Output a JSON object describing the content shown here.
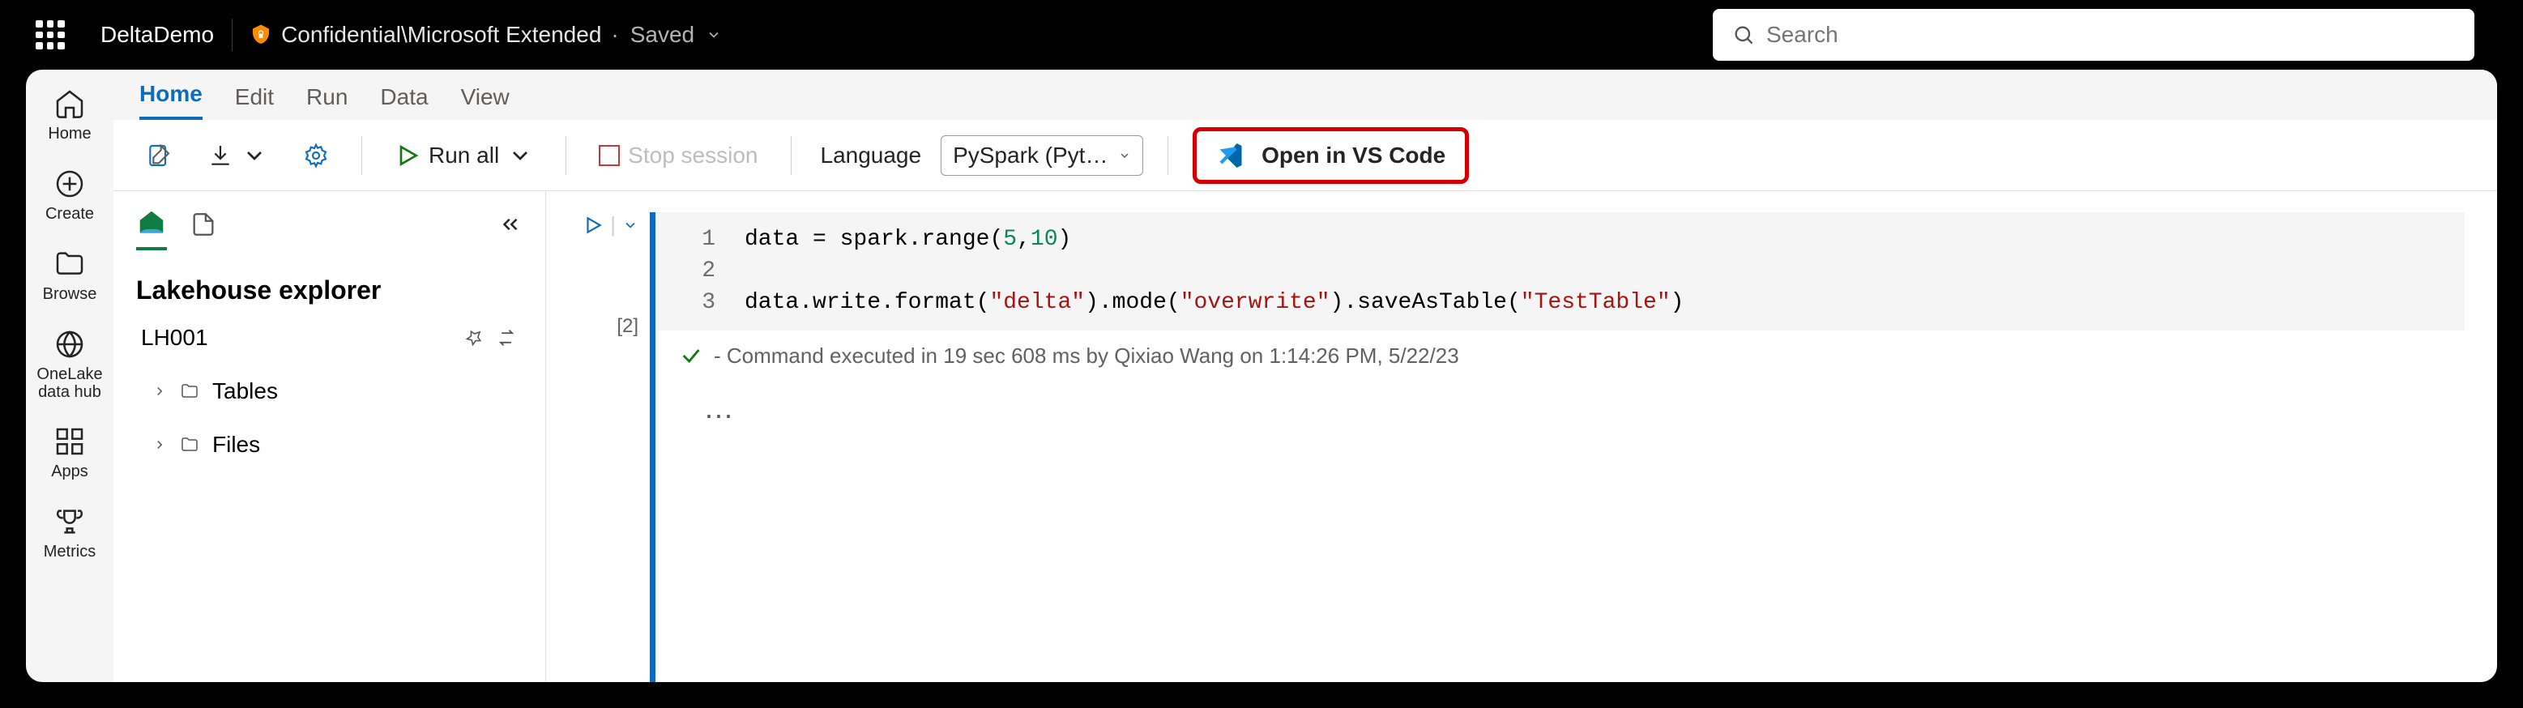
{
  "topbar": {
    "app_name": "DeltaDemo",
    "sensitivity": "Confidential\\Microsoft Extended",
    "save_status": "Saved"
  },
  "search": {
    "placeholder": "Search"
  },
  "left_rail": {
    "items": [
      {
        "id": "home",
        "label": "Home"
      },
      {
        "id": "create",
        "label": "Create"
      },
      {
        "id": "browse",
        "label": "Browse"
      },
      {
        "id": "onelake",
        "label": "OneLake data hub"
      },
      {
        "id": "apps",
        "label": "Apps"
      },
      {
        "id": "metrics",
        "label": "Metrics"
      }
    ]
  },
  "tabs": {
    "items": [
      "Home",
      "Edit",
      "Run",
      "Data",
      "View"
    ],
    "active": "Home"
  },
  "toolbar": {
    "run_all": "Run all",
    "stop_session": "Stop session",
    "language_label": "Language",
    "language_value": "PySpark (Pytho...",
    "vscode_button": "Open in VS Code"
  },
  "explorer": {
    "title": "Lakehouse explorer",
    "selected": "LH001",
    "folders": [
      "Tables",
      "Files"
    ]
  },
  "cell": {
    "execution_count": "[2]",
    "code": {
      "line1_pre": "data = spark.range(",
      "line1_num1": "5",
      "line1_mid": ",",
      "line1_num2": "10",
      "line1_post": ")",
      "line2": "",
      "line3_pre": "data.write.format(",
      "line3_s1": "\"delta\"",
      "line3_m1": ").mode(",
      "line3_s2": "\"overwrite\"",
      "line3_m2": ").saveAsTable(",
      "line3_s3": "\"TestTable\"",
      "line3_post": ")"
    },
    "status": "- Command executed in 19 sec 608 ms by Qixiao Wang on 1:14:26 PM, 5/22/23"
  }
}
